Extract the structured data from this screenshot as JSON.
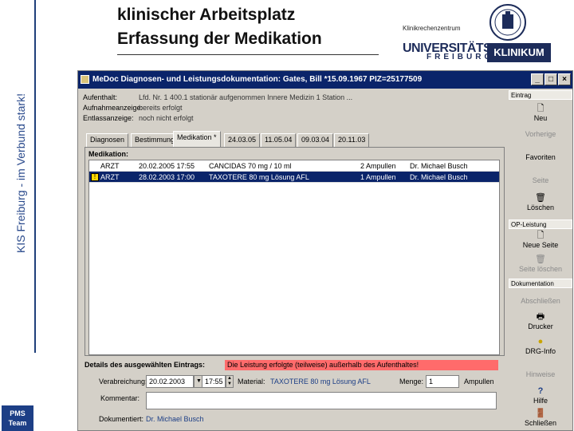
{
  "slide": {
    "title_line1": "klinischer Arbeitsplatz",
    "title_line2": "Erfassung der Medikation",
    "side_text": "KIS Freiburg - im Verbund stark!",
    "logo_label_1": "PMS",
    "logo_label_2": "Team",
    "institute": "Klinikrechenzentrum",
    "uni_text": "UNIVERSITÄTS",
    "freiburg_text": "FREIBURG",
    "klinikum_text": "KLINIKUM"
  },
  "window": {
    "title": "MeDoc Diagnosen- und Leistungsdokumentation: Gates, Bill *15.09.1967 PIZ=25177509",
    "min": "_",
    "max": "□",
    "close": "×"
  },
  "patient": {
    "aufenthalt_label": "Aufenthalt:",
    "aufenthalt_value": "Lfd. Nr. 1 400.1 stationär aufgenommen Innere Medizin 1 Station ...",
    "aufnahme_label": "Aufnahmeanzeige:",
    "aufnahme_value": "bereits erfolgt",
    "entlassung_label": "Entlassanzeige:",
    "entlassung_value": "noch nicht erfolgt"
  },
  "tabs": [
    "Diagnosen",
    "Bestimmung",
    "Medikation *",
    "24.03.05",
    "11.05.04",
    "09.03.04",
    "20.11.03"
  ],
  "medikation": {
    "label": "Medikation:",
    "rows": [
      {
        "typ": "ARZT",
        "datum": "20.02.2005 17:55",
        "mittel": "CANCIDAS 70 mg / 10 ml",
        "menge": "2 Ampullen",
        "arzt": "Dr. Michael Busch",
        "selected": false,
        "warn": false
      },
      {
        "typ": "ARZT",
        "datum": "28.02.2003 17:00",
        "mittel": "TAXOTERE 80 mg Lösung AFL",
        "menge": "1 Ampullen",
        "arzt": "Dr. Michael Busch",
        "selected": true,
        "warn": true
      }
    ]
  },
  "details": {
    "label": "Details des ausgewählten Eintrags:",
    "warning": "Die Leistung erfolgte (teilweise) außerhalb des Aufenthaltes!",
    "verabreichung_label": "Verabreichung:",
    "date_value": "20.02.2003",
    "time_value": "17:55",
    "material_label": "Material:",
    "material_value": "TAXOTERE 80 mg Lösung AFL",
    "menge_label": "Menge:",
    "menge_value": "1",
    "einheit": "Ampullen",
    "kommentar_label": "Kommentar:",
    "kommentar_value": "",
    "dokumentiert_label": "Dokumentiert:",
    "dokumentiert_value": "Dr. Michael Busch"
  },
  "sidebar": {
    "eintrag_head": "Eintrag",
    "neu": "Neu",
    "vorherige": "Vorherige",
    "favoriten": "Favoriten",
    "seite": "Seite",
    "loeschen": "Löschen",
    "opl_head": "OP-Leistung",
    "neue_seite": "Neue Seite",
    "seite_loeschen": "Seite löschen",
    "dok_head": "Dokumentation",
    "abschliessen": "Abschließen",
    "drucker": "Drucker",
    "drg": "DRG-Info",
    "hinweise": "Hinweise",
    "hilfe": "Hilfe",
    "schliessen": "Schließen"
  }
}
